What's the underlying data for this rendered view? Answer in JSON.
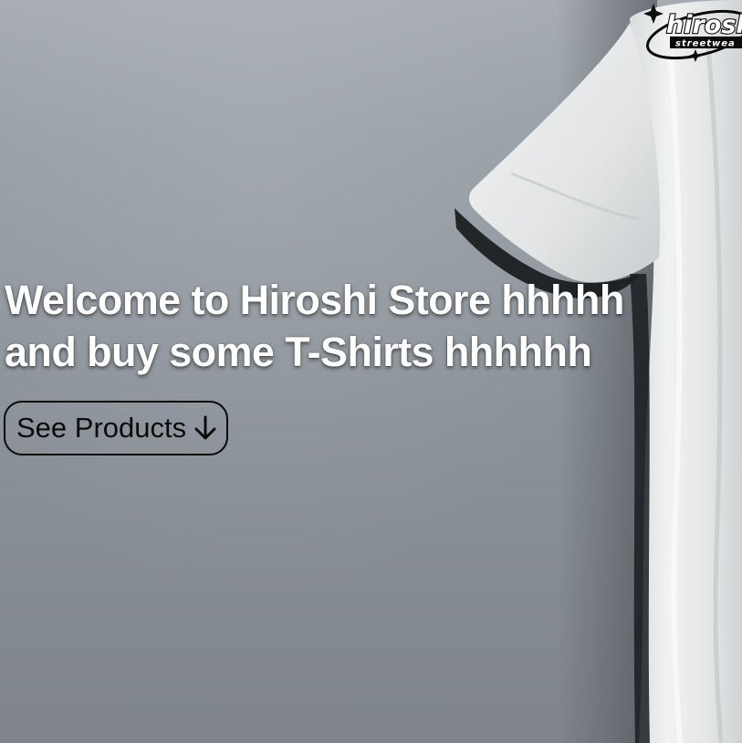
{
  "hero": {
    "title_line_1": "Welcome to Hiroshi Store hhhhh",
    "title_line_2": "and buy some T-Shirts hhhhhh",
    "cta_label": "See Products",
    "cta_icon": "arrow-down-icon",
    "image_subject": "t-shirt-photo",
    "colors": {
      "background": "#8f959b",
      "title": "#ffffff",
      "button_border": "#0a0a0a",
      "button_text": "#0b0b0b"
    }
  },
  "logo": {
    "text": "hiroshi",
    "subtext": "streetwear",
    "icon": "logo-icon"
  }
}
